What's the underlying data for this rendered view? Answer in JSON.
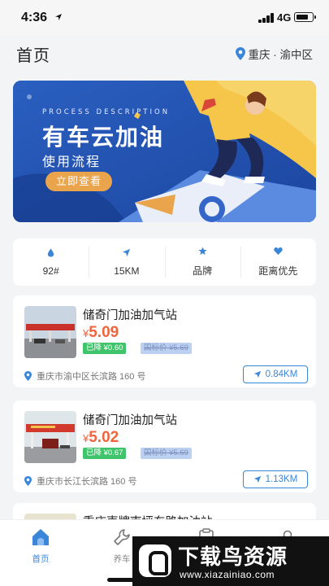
{
  "status_bar": {
    "time": "4:36",
    "network": "4G"
  },
  "header": {
    "title": "首页",
    "city": "重庆 · 渝中区"
  },
  "banner": {
    "subtitle": "PROCESS DESCRIPTION",
    "title": "有车云加油",
    "description": "使用流程",
    "button": "立即查看"
  },
  "filters": [
    {
      "label": "92#",
      "icon": "drop-icon"
    },
    {
      "label": "15KM",
      "icon": "navigation-icon"
    },
    {
      "label": "品牌",
      "icon": "star-icon"
    },
    {
      "label": "距离优先",
      "icon": "heart-icon"
    }
  ],
  "stations": [
    {
      "name": "储奇门加油加气站",
      "currency": "¥",
      "price": "5.09",
      "discount": "已降 ¥0.60",
      "list_price": "国标价 ¥5.69",
      "address": "重庆市渝中区长滨路 160 号",
      "distance": "0.84KM"
    },
    {
      "name": "储奇门加油加气站",
      "currency": "¥",
      "price": "5.02",
      "discount": "已降 ¥0.67",
      "list_price": "国标价 ¥5.69",
      "address": "重庆市长江长滨路 160 号",
      "distance": "1.13KM"
    },
    {
      "name": "重庆壳牌南坪东路加油站"
    }
  ],
  "tabbar": [
    {
      "label": "首页",
      "icon": "home-icon",
      "active": true
    },
    {
      "label": "养车",
      "icon": "wrench-icon",
      "active": false
    },
    {
      "label": "订单",
      "icon": "order-icon",
      "active": false
    },
    {
      "label": "我的",
      "icon": "profile-icon",
      "active": false
    }
  ],
  "watermark": {
    "title": "下载鸟资源",
    "url": "www.xiazainiao.com"
  },
  "colors": {
    "accent": "#3a86d8",
    "price": "#f0643e",
    "discount": "#3fc46b",
    "banner": "#1f4fa9"
  }
}
